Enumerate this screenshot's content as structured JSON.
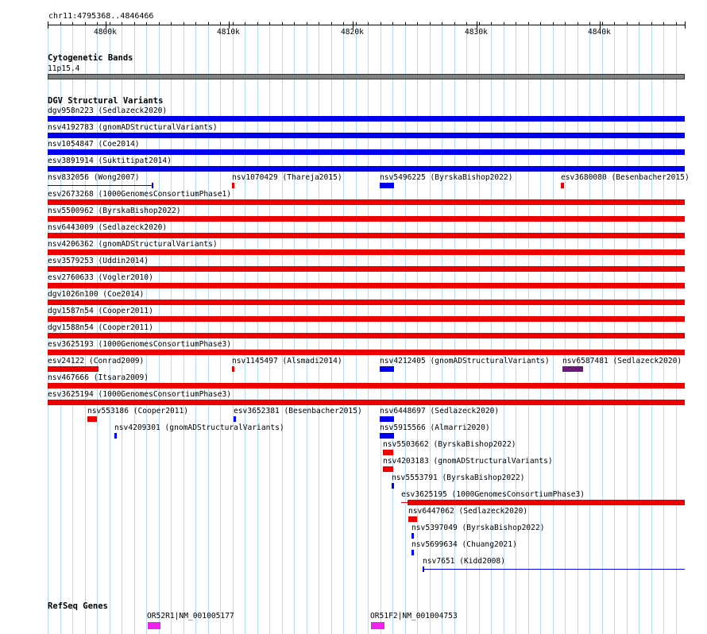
{
  "ruler": {
    "locus": "chr11:4795368..4846466",
    "ticks": [
      "4800k",
      "4810k",
      "4820k",
      "4830k",
      "4840k"
    ]
  },
  "cytobands": {
    "title": "Cytogenetic Bands",
    "band": "11p15.4",
    "color": "#808080"
  },
  "dgv": {
    "title": "DGV Structural Variants",
    "colors": {
      "gain": "#0000ee",
      "loss": "#ee0000",
      "both": "#6a1b7a"
    },
    "features": [
      {
        "label": "dgv958n223 (Sedlazeck2020)",
        "type": "gain"
      },
      {
        "label": "nsv4192783 (gnomADStructuralVariants)",
        "type": "gain"
      },
      {
        "label": "nsv1054847 (Coe2014)",
        "type": "gain"
      },
      {
        "label": "esv3891914 (Suktitipat2014)",
        "type": "gain"
      },
      {
        "label": "nsv832056 (Wong2007)",
        "type": "gain"
      },
      {
        "label": "nsv1070429 (Thareja2015)",
        "type": "loss"
      },
      {
        "label": "nsv5496225 (ByrskaBishop2022)",
        "type": "gain"
      },
      {
        "label": "esv3680080 (Besenbacher2015)",
        "type": "loss"
      },
      {
        "label": "esv2673268 (1000GenomesConsortiumPhase1)",
        "type": "loss"
      },
      {
        "label": "nsv5500962 (ByrskaBishop2022)",
        "type": "loss"
      },
      {
        "label": "nsv6443009 (Sedlazeck2020)",
        "type": "loss"
      },
      {
        "label": "nsv4206362 (gnomADStructuralVariants)",
        "type": "loss"
      },
      {
        "label": "esv3579253 (Uddin2014)",
        "type": "loss"
      },
      {
        "label": "esv2760633 (Vogler2010)",
        "type": "loss"
      },
      {
        "label": "dgv1026n100 (Coe2014)",
        "type": "loss"
      },
      {
        "label": "dgv1587n54 (Cooper2011)",
        "type": "loss"
      },
      {
        "label": "dgv1588n54 (Cooper2011)",
        "type": "loss"
      },
      {
        "label": "esv3625193 (1000GenomesConsortiumPhase3)",
        "type": "loss"
      },
      {
        "label": "esv24122 (Conrad2009)",
        "type": "loss"
      },
      {
        "label": "nsv1145497 (Alsmadi2014)",
        "type": "loss"
      },
      {
        "label": "nsv4212405 (gnomADStructuralVariants)",
        "type": "gain"
      },
      {
        "label": "nsv6587481 (Sedlazeck2020)",
        "type": "both"
      },
      {
        "label": "nsv467666 (Itsara2009)",
        "type": "loss"
      },
      {
        "label": "esv3625194 (1000GenomesConsortiumPhase3)",
        "type": "loss"
      },
      {
        "label": "nsv553186 (Cooper2011)",
        "type": "loss"
      },
      {
        "label": "esv3652381 (Besenbacher2015)",
        "type": "gain"
      },
      {
        "label": "nsv6448697 (Sedlazeck2020)",
        "type": "gain"
      },
      {
        "label": "nsv4209301 (gnomADStructuralVariants)",
        "type": "gain"
      },
      {
        "label": "nsv5915566 (Almarri2020)",
        "type": "gain"
      },
      {
        "label": "nsv5503662 (ByrskaBishop2022)",
        "type": "loss"
      },
      {
        "label": "nsv4203183 (gnomADStructuralVariants)",
        "type": "loss"
      },
      {
        "label": "nsv5553791 (ByrskaBishop2022)",
        "type": "gain"
      },
      {
        "label": "esv3625195 (1000GenomesConsortiumPhase3)",
        "type": "loss"
      },
      {
        "label": "nsv6447062 (Sedlazeck2020)",
        "type": "loss"
      },
      {
        "label": "nsv5397049 (ByrskaBishop2022)",
        "type": "gain"
      },
      {
        "label": "nsv5699634 (Chuang2021)",
        "type": "gain"
      },
      {
        "label": "nsv7651 (Kidd2008)",
        "type": "gain"
      }
    ]
  },
  "refseq": {
    "title": "RefSeq Genes",
    "color": "#ee22ee",
    "genes": [
      {
        "label": "OR52R1|NM_001005177"
      },
      {
        "label": "OR51F2|NM_001004753"
      }
    ]
  }
}
